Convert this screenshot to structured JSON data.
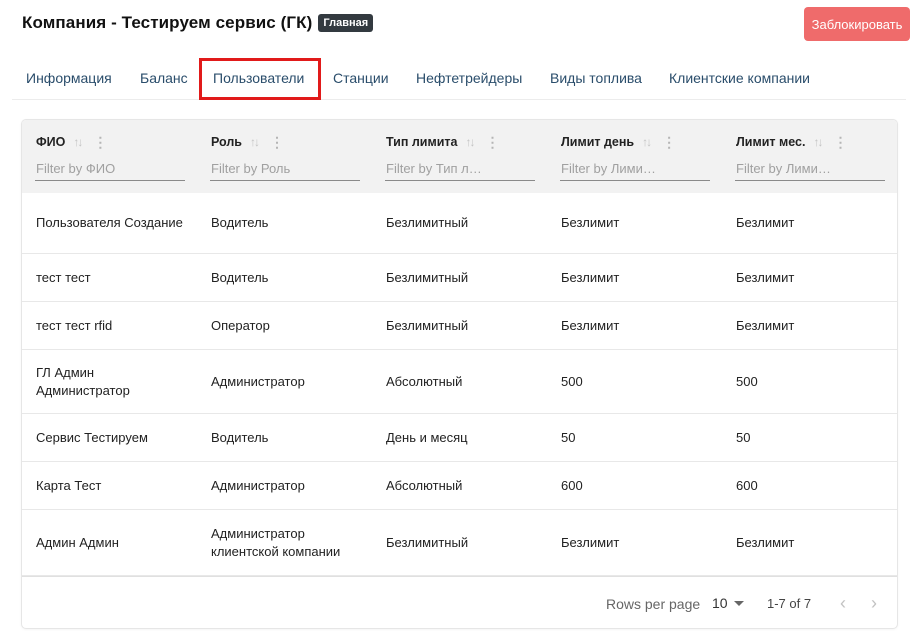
{
  "header": {
    "title": "Компания - Тестируем сервис (ГК)",
    "badge": "Главная",
    "block_button": "Заблокировать"
  },
  "tabs": [
    {
      "label": "Информация"
    },
    {
      "label": "Баланс"
    },
    {
      "label": "Пользователи",
      "active": true
    },
    {
      "label": "Станции"
    },
    {
      "label": "Нефтетрейдеры"
    },
    {
      "label": "Виды топлива"
    },
    {
      "label": "Клиентские компании"
    }
  ],
  "table": {
    "columns": [
      {
        "label": "ФИО",
        "filter_placeholder": "Filter by ФИО"
      },
      {
        "label": "Роль",
        "filter_placeholder": "Filter by Роль"
      },
      {
        "label": "Тип лимита",
        "filter_placeholder": "Filter by Тип л…"
      },
      {
        "label": "Лимит день",
        "filter_placeholder": "Filter by Лими…"
      },
      {
        "label": "Лимит мес.",
        "filter_placeholder": "Filter by Лими…"
      }
    ],
    "rows": [
      {
        "fio": "Пользователя Создание",
        "role": "Водитель",
        "limit_type": "Безлимитный",
        "limit_day": "Безлимит",
        "limit_month": "Безлимит"
      },
      {
        "fio": "тест тест",
        "role": "Водитель",
        "limit_type": "Безлимитный",
        "limit_day": "Безлимит",
        "limit_month": "Безлимит"
      },
      {
        "fio": "тест тест rfid",
        "role": "Оператор",
        "limit_type": "Безлимитный",
        "limit_day": "Безлимит",
        "limit_month": "Безлимит"
      },
      {
        "fio": "ГЛ Админ Администратор",
        "role": "Администратор",
        "limit_type": "Абсолютный",
        "limit_day": "500",
        "limit_month": "500"
      },
      {
        "fio": "Сервис Тестируем",
        "role": "Водитель",
        "limit_type": "День и месяц",
        "limit_day": "50",
        "limit_month": "50"
      },
      {
        "fio": "Карта Тест",
        "role": "Администратор",
        "limit_type": "Абсолютный",
        "limit_day": "600",
        "limit_month": "600"
      },
      {
        "fio": "Админ Админ",
        "role": "Администратор клиентской компании",
        "limit_type": "Безлимитный",
        "limit_day": "Безлимит",
        "limit_month": "Безлимит"
      }
    ]
  },
  "pagination": {
    "rows_per_page_label": "Rows per page",
    "rows_per_page": "10",
    "page_info": "1-7 of 7"
  },
  "colors": {
    "block_button": "#ef6b6b",
    "tab_text": "#2a4d6b",
    "highlight": "#e11a1a"
  }
}
